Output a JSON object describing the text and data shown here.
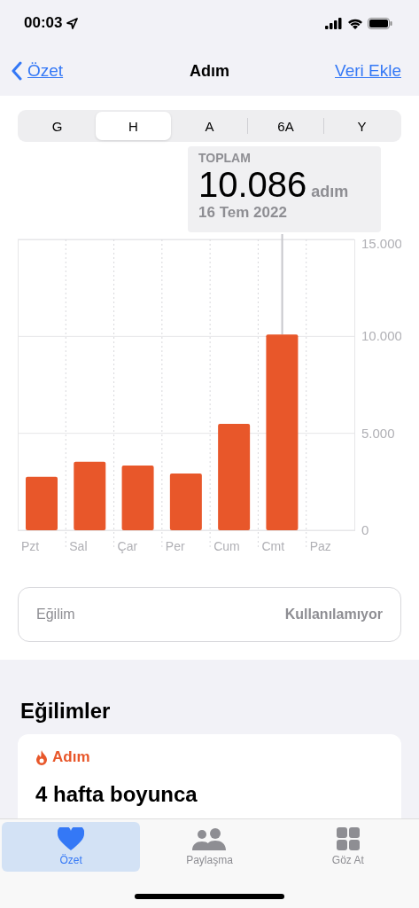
{
  "status_bar": {
    "time": "00:03"
  },
  "nav": {
    "back": "Özet",
    "title": "Adım",
    "action": "Veri Ekle"
  },
  "segments": [
    {
      "label": "G",
      "selected": false
    },
    {
      "label": "H",
      "selected": true
    },
    {
      "label": "A",
      "selected": false
    },
    {
      "label": "6A",
      "selected": false
    },
    {
      "label": "Y",
      "selected": false
    }
  ],
  "tooltip": {
    "caption": "TOPLAM",
    "value": "10.086",
    "unit": "adım",
    "date": "16 Tem 2022"
  },
  "chart_data": {
    "type": "bar",
    "categories": [
      "Pzt",
      "Sal",
      "Çar",
      "Per",
      "Cum",
      "Cmt",
      "Paz"
    ],
    "series": [
      {
        "color": "#e8572a",
        "values": [
          2750,
          3530,
          3340,
          2930,
          5490,
          10100,
          null
        ]
      }
    ],
    "ylim": [
      0,
      15000
    ],
    "yticks": [
      {
        "value": 0,
        "label": "0"
      },
      {
        "value": 5000,
        "label": "5.000"
      },
      {
        "value": 10000,
        "label": "10.000"
      },
      {
        "value": 15000,
        "label": "15.000"
      }
    ]
  },
  "trend_row": {
    "label": "Eğilim",
    "value": "Kullanılamıyor"
  },
  "trends": {
    "heading": "Eğilimler",
    "card": {
      "category": "Adım",
      "title": "4 hafta boyunca"
    }
  },
  "tab_bar": [
    {
      "label": "Özet",
      "kind": "heart",
      "selected": true
    },
    {
      "label": "Paylaşma",
      "kind": "people",
      "selected": false
    },
    {
      "label": "Göz At",
      "kind": "grid",
      "selected": false
    }
  ]
}
